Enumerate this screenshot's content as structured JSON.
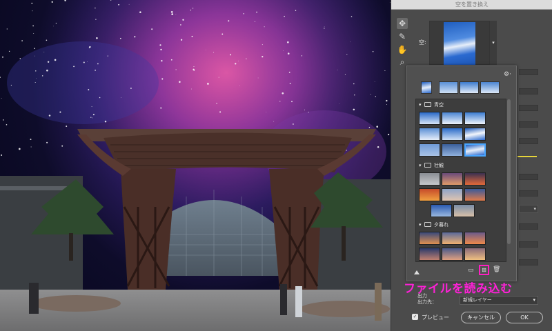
{
  "dialog": {
    "title": "空を置き換え",
    "sky_label": "空:",
    "output_label": "出力",
    "output_dest_label": "出力先：",
    "output_dest_value": "新規レイヤー",
    "preview_label": "プレビュー",
    "cancel_label": "キャンセル",
    "ok_label": "OK",
    "preview_checked": true
  },
  "popup": {
    "groups": [
      {
        "name": "青空",
        "thumb_count": 9,
        "selected_index": 8
      },
      {
        "name": "壮観",
        "thumb_count": 8
      },
      {
        "name": "夕暮れ",
        "thumb_count": 6
      }
    ]
  },
  "annotation": {
    "text": "ファイルを読み込む",
    "color": "#ff20d8"
  },
  "colors": {
    "selection_border": "#49a6ff",
    "highlight": "#ff1ec3",
    "slider_accent": "#e6d53a"
  },
  "icons": [
    "move-icon",
    "sky-brush-icon",
    "hand-icon",
    "zoom-icon",
    "gear-icon",
    "folder-icon",
    "new-preset-icon",
    "trash-icon",
    "chevron-down-icon"
  ]
}
